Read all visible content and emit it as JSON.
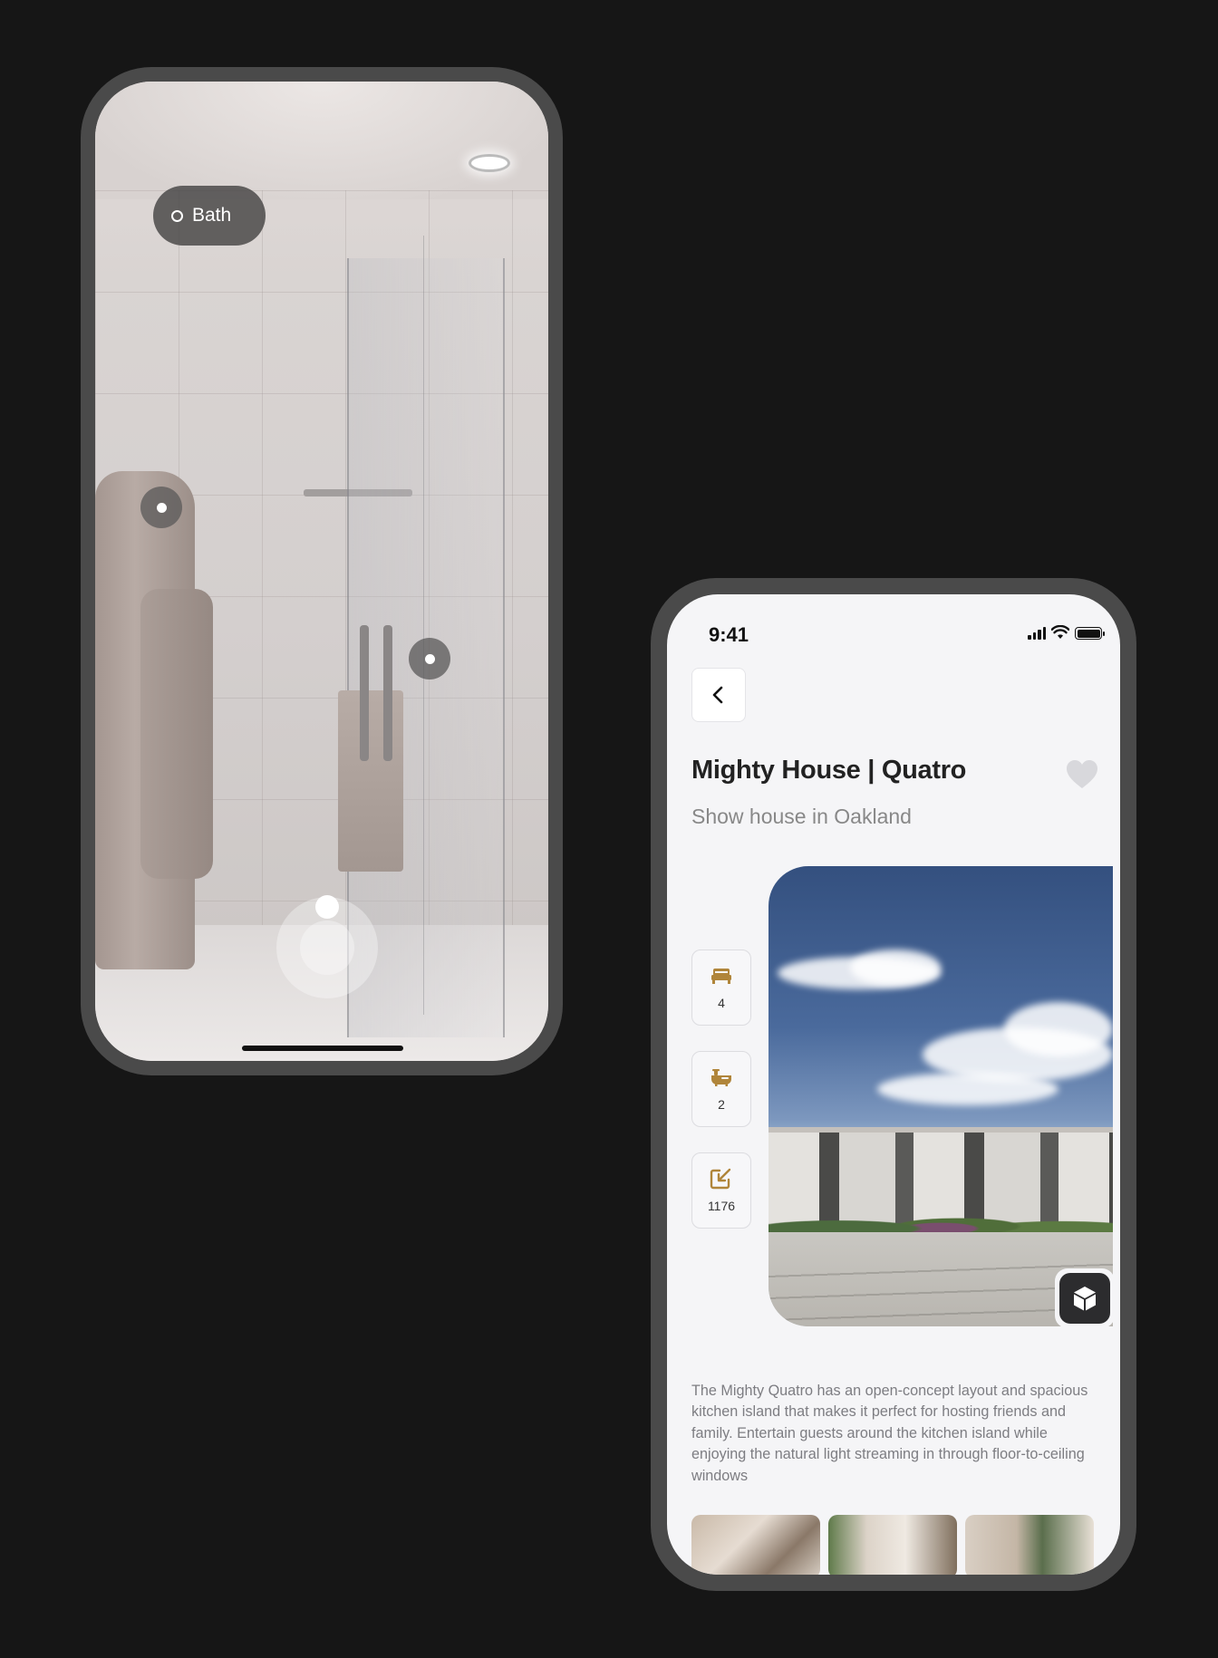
{
  "ar_view": {
    "room_label": "Bath"
  },
  "property": {
    "status_time": "9:41",
    "title": "Mighty House | Quatro",
    "subtitle": "Show house in Oakland",
    "stats": {
      "bedrooms": "4",
      "bathrooms": "2",
      "area": "1176"
    },
    "description": "The Mighty Quatro has an open-concept layout and spacious kitchen island that makes it perfect for hosting friends and family. Entertain guests around the kitchen island while enjoying the natural light streaming in through floor-to-ceiling windows",
    "icons": {
      "back": "chevron-left-icon",
      "favorite": "heart-icon",
      "bedrooms": "bed-icon",
      "bathrooms": "bathtub-icon",
      "area": "resize-arrow-icon",
      "view_3d": "cube-icon"
    }
  },
  "colors": {
    "accent": "#b0853a",
    "background": "#161616",
    "phone_frame": "#4a4a4a"
  }
}
